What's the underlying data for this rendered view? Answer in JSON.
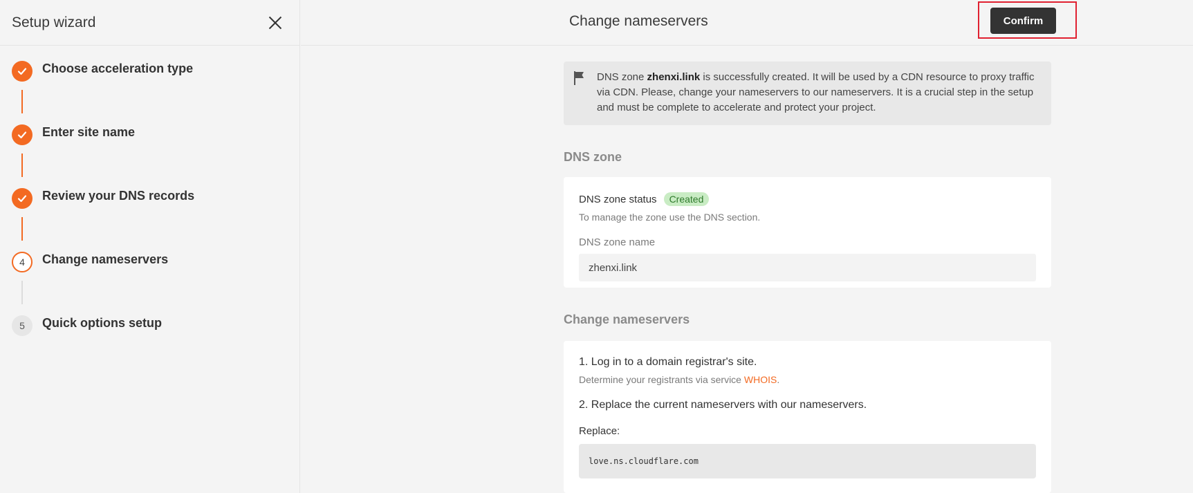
{
  "sidebar": {
    "title": "Setup wizard",
    "steps": [
      {
        "label": "Choose acceleration type",
        "state": "done"
      },
      {
        "label": "Enter site name",
        "state": "done"
      },
      {
        "label": "Review your DNS records",
        "state": "done"
      },
      {
        "label": "Change nameservers",
        "state": "active",
        "number": "4"
      },
      {
        "label": "Quick options setup",
        "state": "pending",
        "number": "5"
      }
    ]
  },
  "header": {
    "title": "Change nameservers",
    "confirm_label": "Confirm"
  },
  "info": {
    "prefix": "DNS zone ",
    "zone": "zhenxi.link",
    "message": " is successfully created. It will be used by a CDN resource to proxy traffic via CDN. Please, change your nameservers to our nameservers. It is a crucial step in the setup and must be complete to accelerate and protect your project."
  },
  "dns_zone": {
    "section_title": "DNS zone",
    "status_label": "DNS zone status",
    "status_badge": "Created",
    "manage_text": "To manage the zone use the DNS section.",
    "name_label": "DNS zone name",
    "name_value": "zhenxi.link"
  },
  "nameservers": {
    "section_title": "Change nameservers",
    "step1": "1. Log in to a domain registrar's site.",
    "determine_prefix": "Determine your registrants via service ",
    "whois_link": "WHOIS",
    "determine_suffix": ".",
    "step2": "2. Replace the current nameservers with our nameservers.",
    "replace_label": "Replace:",
    "current_ns": "love.ns.cloudflare.com"
  },
  "colors": {
    "accent": "#f36a22",
    "highlight_border": "#e02030",
    "badge_bg": "#c9ecc4"
  }
}
